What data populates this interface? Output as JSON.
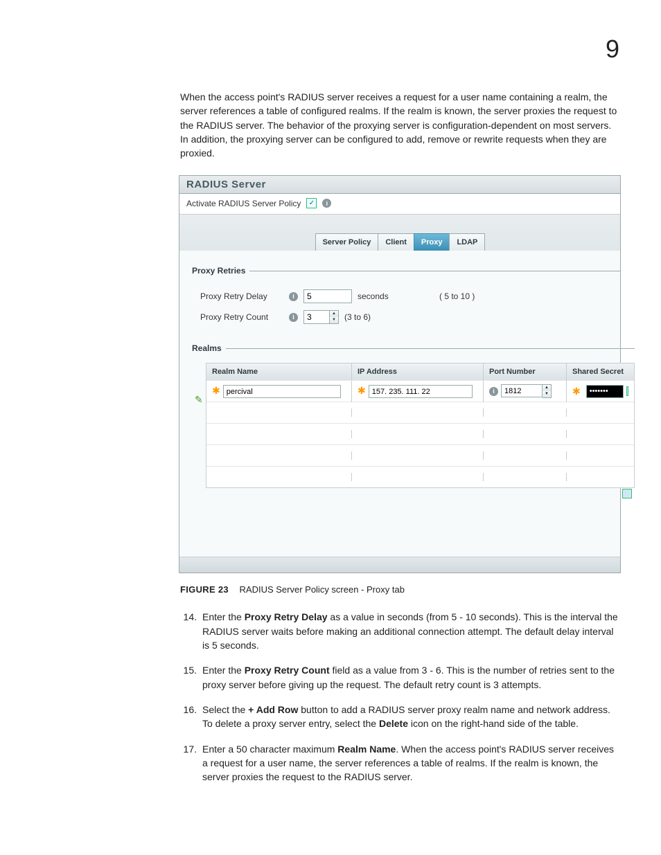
{
  "pageNumber": "9",
  "intro": "When the access point's RADIUS server receives a request for a user name containing a realm, the server references a table of configured realms. If the realm is known, the server proxies the request to the RADIUS server. The behavior of the proxying server is configuration-dependent on most servers. In addition, the proxying server can be configured to add, remove or rewrite requests when they are proxied.",
  "panel": {
    "title": "RADIUS Server",
    "activateLabel": "Activate RADIUS Server Policy",
    "activateChecked": true,
    "tabs": [
      "Server Policy",
      "Client",
      "Proxy",
      "LDAP"
    ],
    "activeTab": "Proxy"
  },
  "proxyRetries": {
    "legend": "Proxy Retries",
    "delayLabel": "Proxy Retry Delay",
    "delayValue": "5",
    "delayUnit": "seconds",
    "delayRange": "( 5 to 10 )",
    "countLabel": "Proxy Retry Count",
    "countValue": "3",
    "countRange": "(3 to 6)"
  },
  "realms": {
    "legend": "Realms",
    "headers": [
      "Realm Name",
      "IP Address",
      "Port Number",
      "Shared Secret"
    ],
    "row": {
      "name": "percival",
      "ip": "157. 235. 111. 22",
      "port": "1812",
      "secret": "•••••••"
    }
  },
  "figure": {
    "num": "FIGURE 23",
    "title": "RADIUS Server Policy screen - Proxy tab"
  },
  "steps": {
    "14": {
      "pre": "Enter the ",
      "b": "Proxy Retry Delay",
      "post": " as a value in seconds (from 5 - 10 seconds). This is the interval the RADIUS server waits before making an additional connection attempt. The default delay interval is 5 seconds."
    },
    "15": {
      "pre": "Enter the ",
      "b": "Proxy Retry Count",
      "post": " field as a value from 3 - 6. This is the number of retries sent to the proxy server before giving up the request. The default retry count is 3 attempts."
    },
    "16": {
      "pre": "Select the ",
      "b": "+ Add Row",
      "mid": " button to add a RADIUS server proxy realm name and network address. To delete a proxy server entry, select the ",
      "b2": "Delete",
      "post": " icon on the right-hand side of the table."
    },
    "17": {
      "pre": "Enter a 50 character maximum ",
      "b": "Realm Name",
      "post": ". When the access point's RADIUS server receives a request for a user name, the server references a table of realms. If the realm is known, the server proxies the request to the RADIUS server."
    }
  }
}
